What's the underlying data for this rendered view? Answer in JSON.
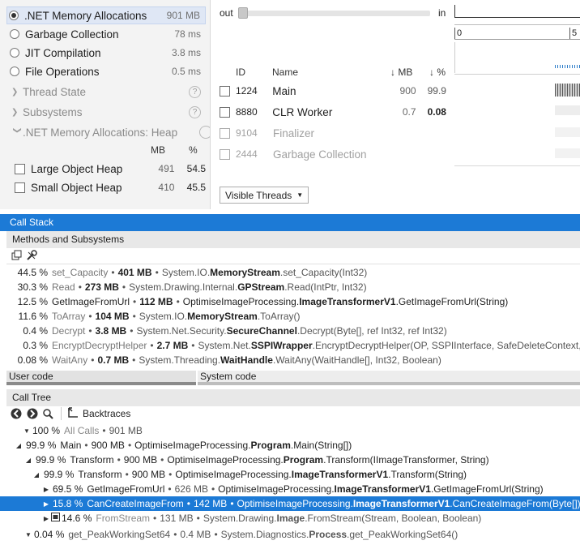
{
  "memory_types": {
    "items": [
      {
        "label": ".NET Memory Allocations",
        "value": "901 MB",
        "selected": true
      },
      {
        "label": "Garbage Collection",
        "value": "78 ms",
        "selected": false
      },
      {
        "label": "JIT Compilation",
        "value": "3.8 ms",
        "selected": false
      },
      {
        "label": "File Operations",
        "value": "0.5 ms",
        "selected": false
      }
    ]
  },
  "sections": {
    "thread_state": "Thread State",
    "subsystems": "Subsystems",
    "heap": ".NET Memory Allocations: Heap",
    "help_glyph": "?"
  },
  "heap": {
    "col_mb": "MB",
    "col_pct": "%",
    "rows": [
      {
        "label": "Large Object Heap",
        "mb": "491",
        "pct": "54.5"
      },
      {
        "label": "Small Object Heap",
        "mb": "410",
        "pct": "45.5"
      }
    ]
  },
  "timeline": {
    "out_label": "out",
    "in_label": "in",
    "tick_0": "0",
    "tick_5": "5"
  },
  "threads": {
    "headers": {
      "id": "ID",
      "name": "Name",
      "mb": "↓ MB",
      "pct": "↓ %"
    },
    "rows": [
      {
        "id": "1224",
        "name": "Main",
        "mb": "900",
        "pct": "99.9",
        "dim": false
      },
      {
        "id": "8880",
        "name": "CLR Worker",
        "mb": "0.7",
        "pct": "0.08",
        "dim": false
      },
      {
        "id": "9104",
        "name": "Finalizer",
        "mb": "",
        "pct": "",
        "dim": true
      },
      {
        "id": "2444",
        "name": "Garbage Collection",
        "mb": "",
        "pct": "",
        "dim": true
      }
    ],
    "visible_threads_button": "Visible Threads"
  },
  "call_stack": {
    "title": "Call Stack",
    "methods_title": "Methods and Subsystems",
    "methods": [
      {
        "pct": "44.5 %",
        "name": "set_Capacity",
        "mb": "401 MB",
        "ns": "System.IO.",
        "cls": "MemoryStream",
        "sig": ".set_Capacity(Int32)"
      },
      {
        "pct": "30.3 %",
        "name": "Read",
        "mb": "273 MB",
        "ns": "System.Drawing.Internal.",
        "cls": "GPStream",
        "sig": ".Read(IntPtr, Int32)"
      },
      {
        "pct": "12.5 %",
        "name": "GetImageFromUrl",
        "mb": "112 MB",
        "ns": "OptimiseImageProcessing.",
        "cls": "ImageTransformerV1",
        "sig": ".GetImageFromUrl(String)"
      },
      {
        "pct": "11.6 %",
        "name": "ToArray",
        "mb": "104 MB",
        "ns": "System.IO.",
        "cls": "MemoryStream",
        "sig": ".ToArray()"
      },
      {
        "pct": "0.4 %",
        "name": "Decrypt",
        "mb": "3.8 MB",
        "ns": "System.Net.Security.",
        "cls": "SecureChannel",
        "sig": ".Decrypt(Byte[], ref Int32, ref Int32)"
      },
      {
        "pct": "0.3 %",
        "name": "EncryptDecryptHelper",
        "mb": "2.7 MB",
        "ns": "System.Net.",
        "cls": "SSPIWrapper",
        "sig": ".EncryptDecryptHelper(OP, SSPIInterface, SafeDeleteContext, S"
      },
      {
        "pct": "0.08 %",
        "name": "WaitAny",
        "mb": "0.7 MB",
        "ns": "System.Threading.",
        "cls": "WaitHandle",
        "sig": ".WaitAny(WaitHandle[], Int32, Boolean)"
      }
    ],
    "user_code": "User code",
    "system_code": "System code",
    "bullet": "•"
  },
  "call_tree": {
    "title": "Call Tree",
    "backtraces": "Backtraces",
    "rows": [
      {
        "pct": "100 %",
        "text": "All Calls",
        "mb": "901 MB",
        "ns": "",
        "cls": "",
        "sig": ""
      },
      {
        "pct": "99.9 %",
        "text": "Main",
        "mb": "900 MB",
        "ns": "OptimiseImageProcessing.",
        "cls": "Program",
        "sig": ".Main(String[])"
      },
      {
        "pct": "99.9 %",
        "text": "Transform",
        "mb": "900 MB",
        "ns": "OptimiseImageProcessing.",
        "cls": "Program",
        "sig": ".Transform(IImageTransformer, String)"
      },
      {
        "pct": "99.9 %",
        "text": "Transform",
        "mb": "900 MB",
        "ns": "OptimiseImageProcessing.",
        "cls": "ImageTransformerV1",
        "sig": ".Transform(String)"
      },
      {
        "pct": "69.5 %",
        "text": "GetImageFromUrl",
        "mb": "626 MB",
        "ns": "OptimiseImageProcessing.",
        "cls": "ImageTransformerV1",
        "sig": ".GetImageFromUrl(String)"
      },
      {
        "pct": "15.8 %",
        "text": "CanCreateImageFrom",
        "mb": "142 MB",
        "ns": "OptimiseImageProcessing.",
        "cls": "ImageTransformerV1",
        "sig": ".CanCreateImageFrom(Byte[])"
      },
      {
        "pct": "14.6 %",
        "text": "FromStream",
        "mb": "131 MB",
        "ns": "System.Drawing.",
        "cls": "Image",
        "sig": ".FromStream(Stream, Boolean, Boolean)"
      },
      {
        "pct": "0.04 %",
        "text": "get_PeakWorkingSet64",
        "mb": "0.4 MB",
        "ns": "System.Diagnostics.",
        "cls": "Process",
        "sig": ".get_PeakWorkingSet64()"
      }
    ]
  },
  "colors": {
    "accent": "#1c7ad6",
    "selection": "#1c7ad6"
  }
}
